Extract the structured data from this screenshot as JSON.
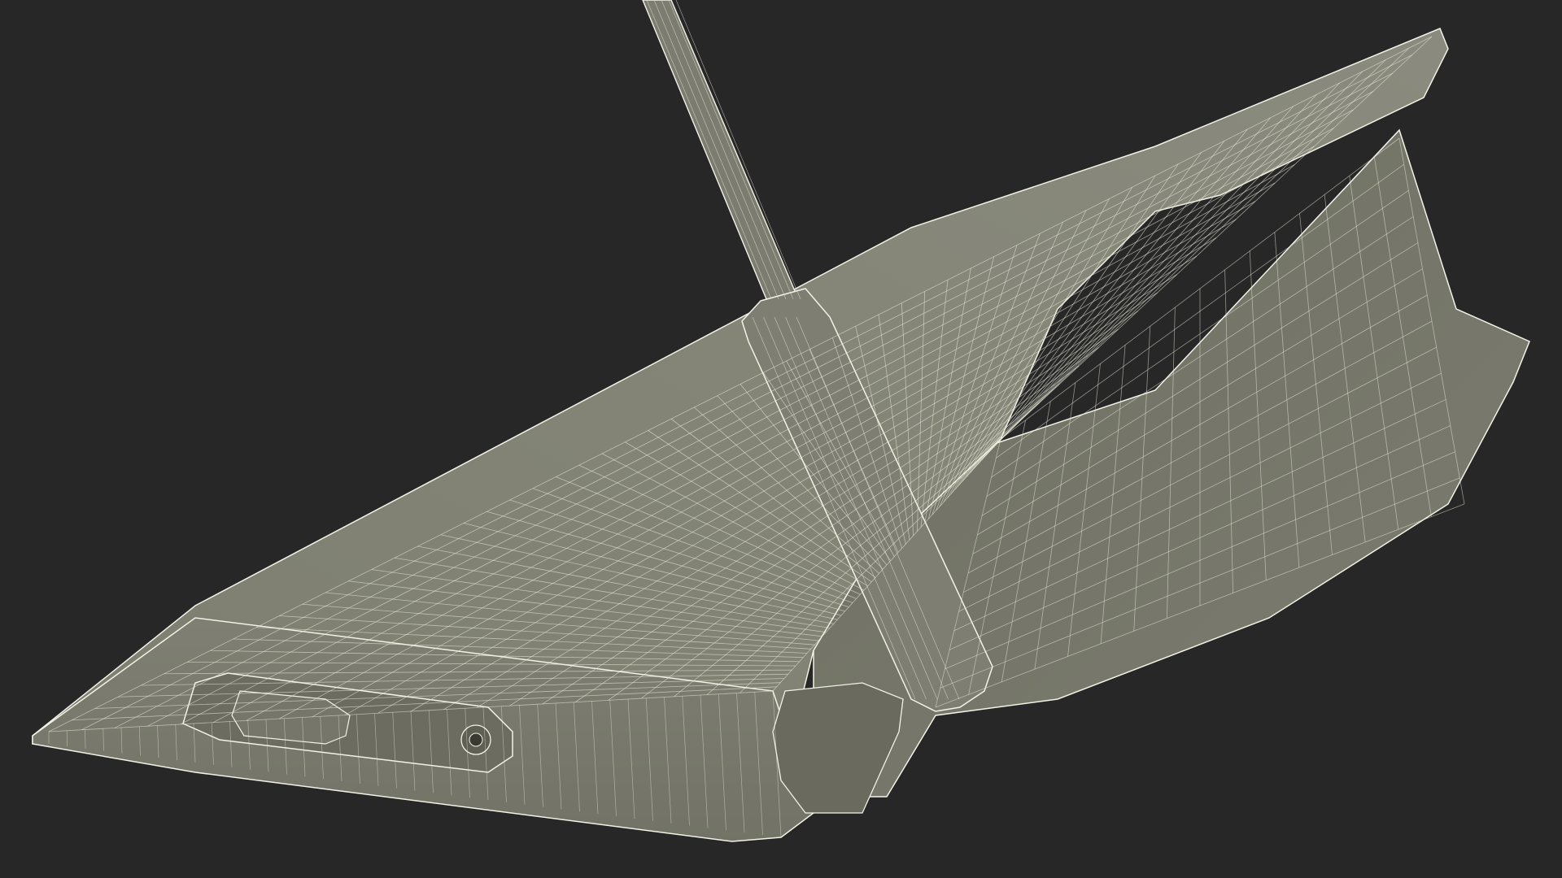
{
  "scene": {
    "background_color": "#272727",
    "surface_color": "#7a7b6c",
    "surface_dark_color": "#6e6f61",
    "surface_light_color": "#85867a",
    "wire_color": "#e9ead9",
    "view_mode": "wireframe-on-shaded",
    "subject": "stand-device-model"
  }
}
